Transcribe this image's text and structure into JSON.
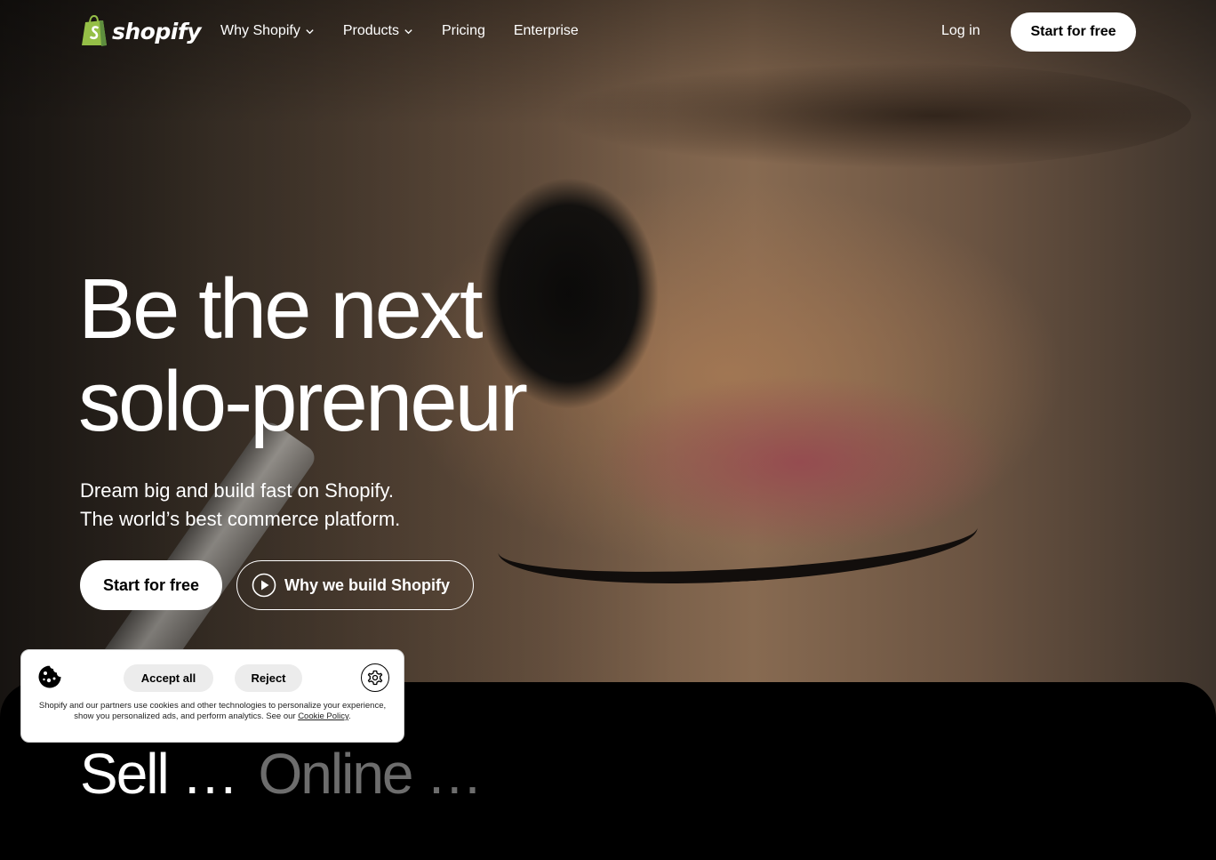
{
  "brand": {
    "name": "shopify",
    "accent": "#95bf47"
  },
  "nav": {
    "items": [
      {
        "label": "Why Shopify",
        "dropdown": true
      },
      {
        "label": "Products",
        "dropdown": true
      },
      {
        "label": "Pricing",
        "dropdown": false
      },
      {
        "label": "Enterprise",
        "dropdown": false
      }
    ],
    "login": "Log in",
    "cta": "Start for free"
  },
  "hero": {
    "headline_line1": "Be the next",
    "headline_line2": "solo-preneur",
    "sub_line1": "Dream big and build fast on Shopify.",
    "sub_line2": "The world’s best commerce platform.",
    "primary_cta": "Start for free",
    "secondary_cta": "Why we build Shopify",
    "secondary_icon": "play-circle-icon"
  },
  "section": {
    "heading_part_a": "Sell …",
    "heading_part_b": "Online …"
  },
  "cookie": {
    "accept": "Accept all",
    "reject": "Reject",
    "text": "Shopify and our partners use cookies and other technologies to personalize your experience, show you personalized ads, and perform analytics. See our",
    "link": "Cookie Policy",
    "icons": [
      "cookie-icon",
      "gear-icon"
    ]
  }
}
